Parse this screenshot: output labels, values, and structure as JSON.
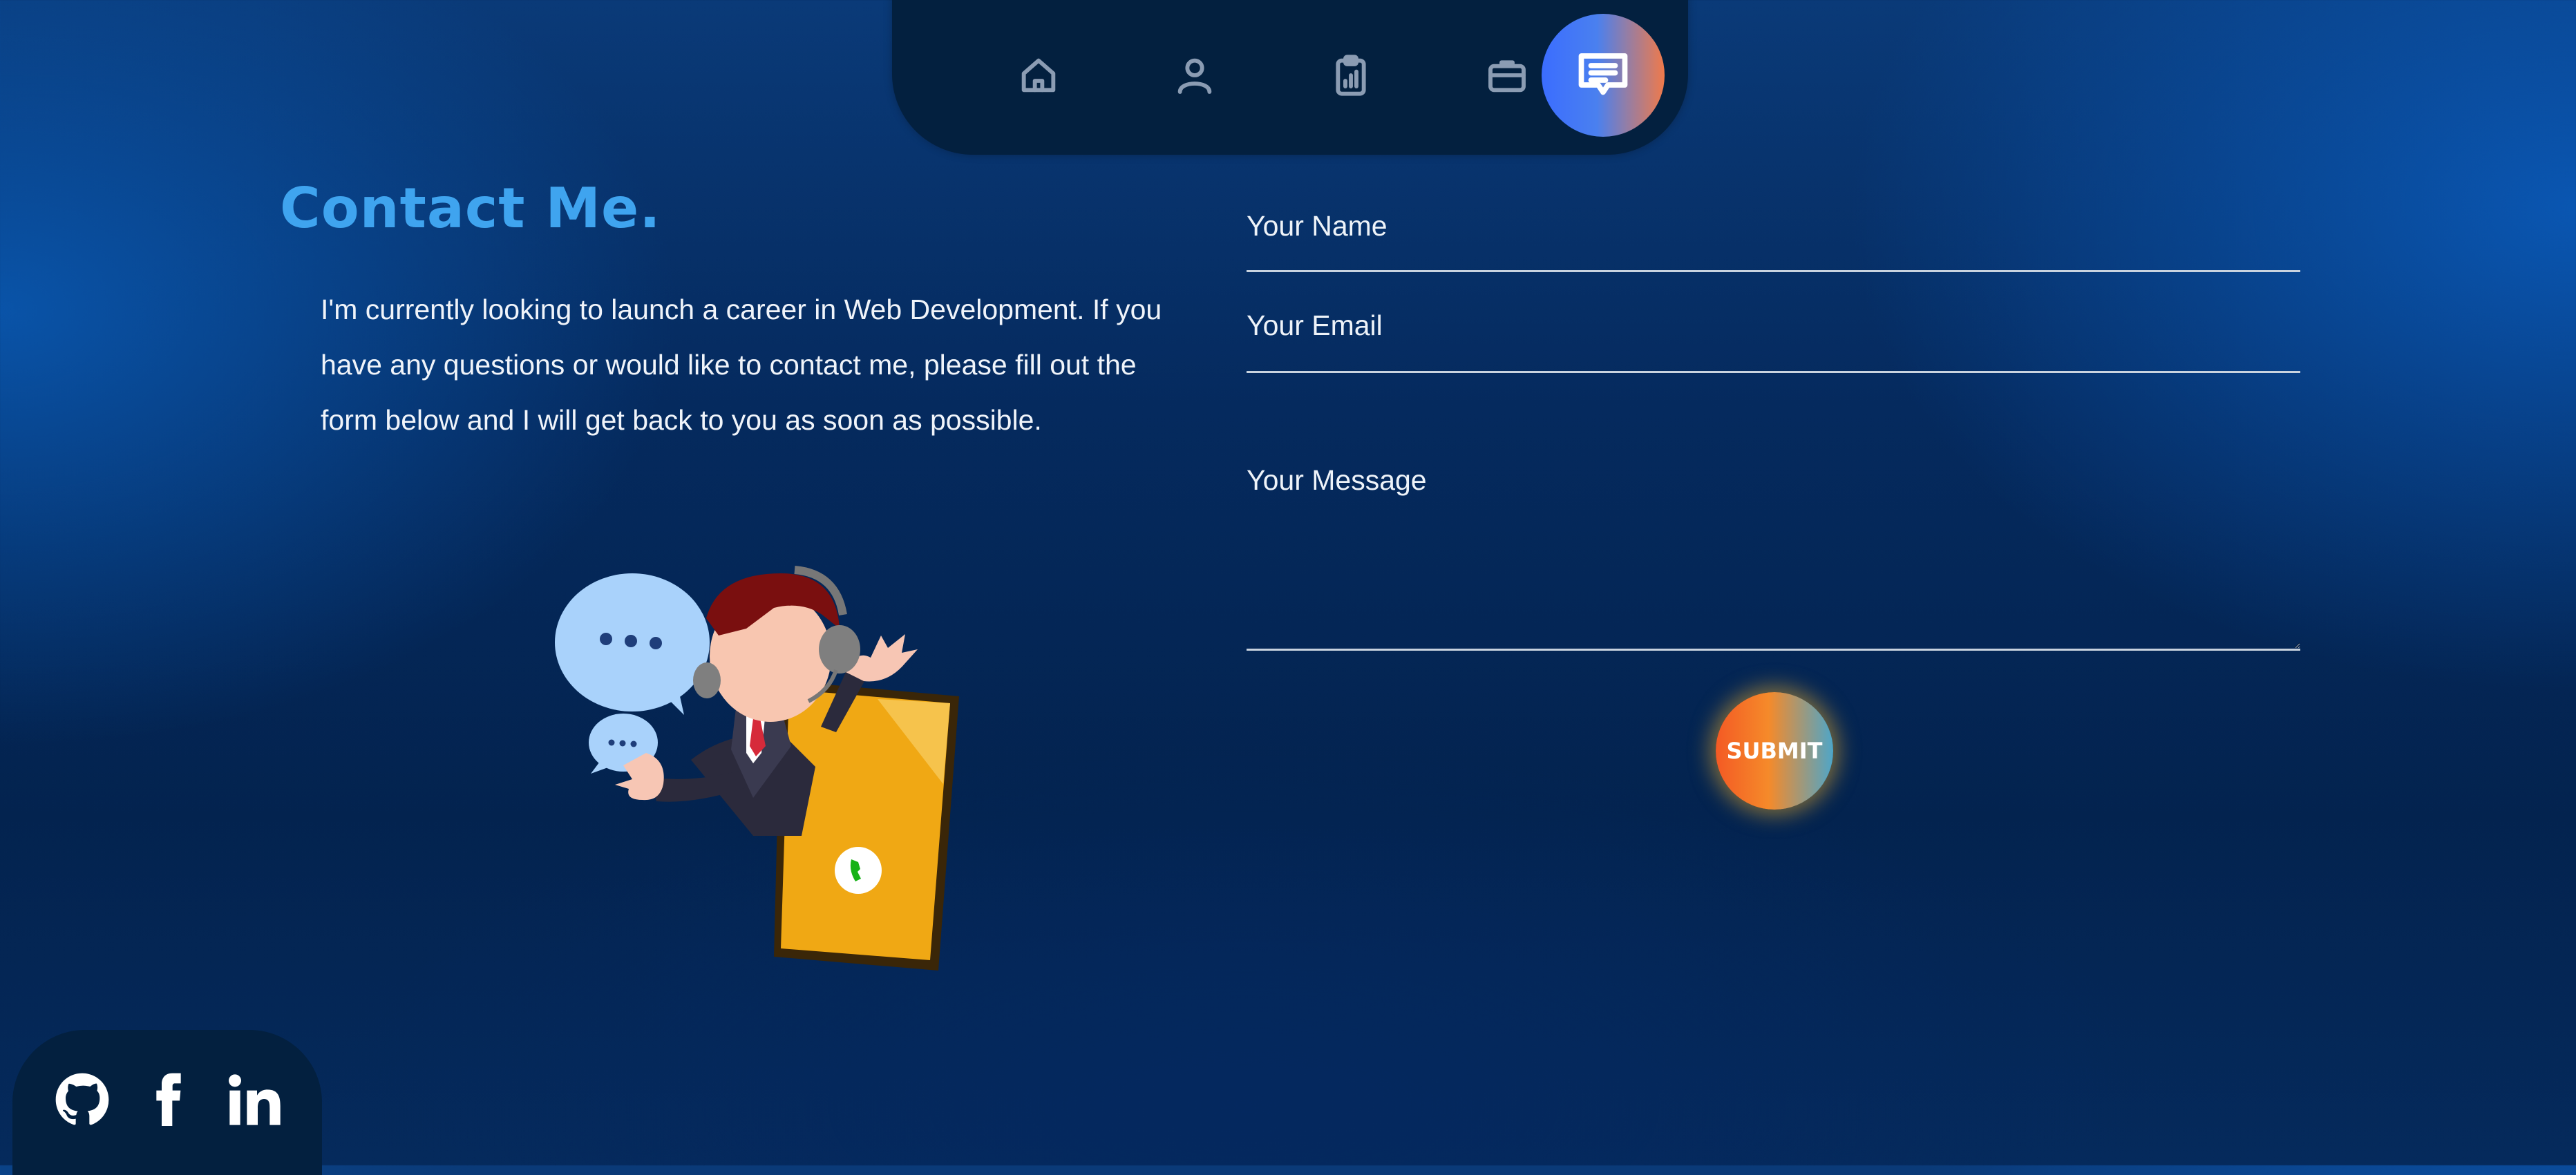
{
  "nav": {
    "items": [
      {
        "icon": "home-icon",
        "active": false
      },
      {
        "icon": "user-icon",
        "active": false
      },
      {
        "icon": "clipboard-chart-icon",
        "active": false
      },
      {
        "icon": "briefcase-icon",
        "active": false
      },
      {
        "icon": "message-icon",
        "active": true
      }
    ]
  },
  "contact": {
    "title": "Contact Me.",
    "intro": "I'm currently looking to launch a career in Web Development. If you have any questions or would like to contact me, please fill out the form below and I will get back to you as soon as possible."
  },
  "form": {
    "name_placeholder": "Your Name",
    "email_placeholder": "Your Email",
    "message_placeholder": "Your Message",
    "submit_label": "SUBMIT"
  },
  "social": {
    "items": [
      {
        "icon": "github-icon"
      },
      {
        "icon": "facebook-icon"
      },
      {
        "icon": "linkedin-icon"
      }
    ]
  },
  "colors": {
    "accent_title": "#3fa4ef",
    "nav_bg": "#03203f",
    "active_gradient_start": "#3b6dff",
    "active_gradient_end": "#f07a4a",
    "submit_gradient_start": "#f45a24",
    "submit_gradient_end": "#4ea6c8"
  }
}
